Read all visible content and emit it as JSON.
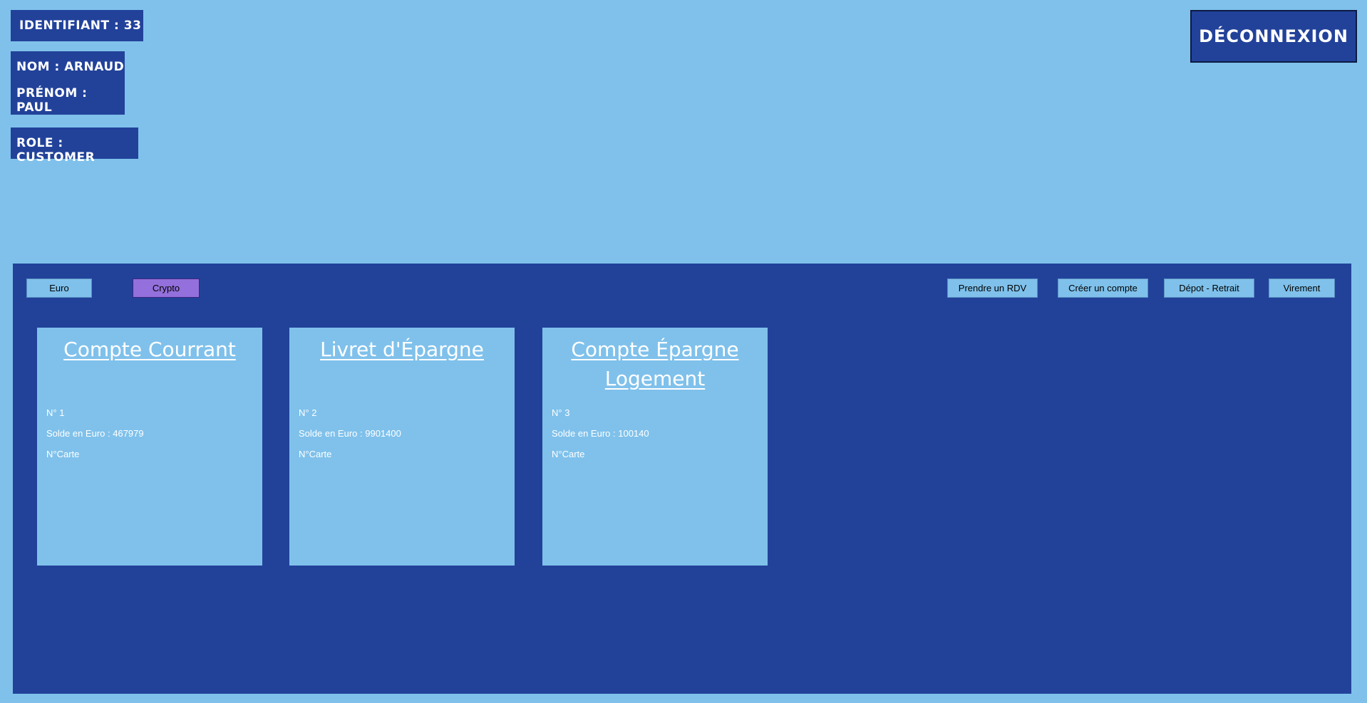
{
  "user": {
    "id_label": "Identifiant : 33",
    "nom_label": "Nom : Arnaud",
    "prenom_label": "Prénom : Paul",
    "role_label": "Role : Customer"
  },
  "header": {
    "logout_label": "Déconnexion"
  },
  "toolbar": {
    "euro_label": "Euro",
    "crypto_label": "Crypto",
    "rdv_label": "Prendre un RDV",
    "create_label": "Créer un compte",
    "depot_label": "Dépot - Retrait",
    "virement_label": "Virement"
  },
  "colors": {
    "background": "#7fc1eb",
    "panel": "#22429a",
    "crypto_active": "#9370db"
  },
  "accounts": [
    {
      "title": "Compte Courrant",
      "number": "N° 1",
      "balance": "Solde en Euro :  467979",
      "card": "N°Carte"
    },
    {
      "title": "Livret d'Épargne",
      "number": "N° 2",
      "balance": "Solde en Euro :  9901400",
      "card": "N°Carte"
    },
    {
      "title": "Compte Épargne Logement",
      "number": "N° 3",
      "balance": "Solde en Euro :  100140",
      "card": "N°Carte"
    }
  ]
}
